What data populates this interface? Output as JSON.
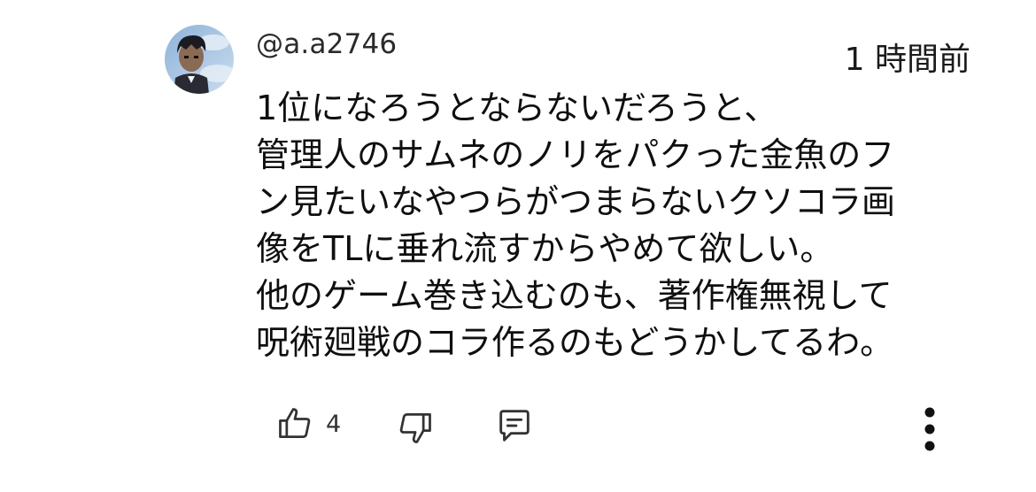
{
  "comment": {
    "author": "@a.a2746",
    "time": "1 時間前",
    "lines": [
      "1位になろうとならないだろうと、",
      "管理人のサムネのノリをパクった金魚のフ",
      "ン見たいなやつらがつまらないクソコラ画",
      "像をTLに垂れ流すからやめて欲しい。",
      "他のゲーム巻き込むのも、著作権無視して",
      "呪術廻戦のコラ作るのもどうかしてるわ。"
    ],
    "like_count": "4"
  },
  "icons": {
    "avatar": "avatar-image",
    "like": "thumb-up-icon",
    "dislike": "thumb-down-icon",
    "reply": "reply-comment-icon",
    "more": "more-vertical-icon"
  },
  "colors": {
    "text": "#0f0f0f",
    "secondary_text": "#333333",
    "background": "#ffffff"
  }
}
